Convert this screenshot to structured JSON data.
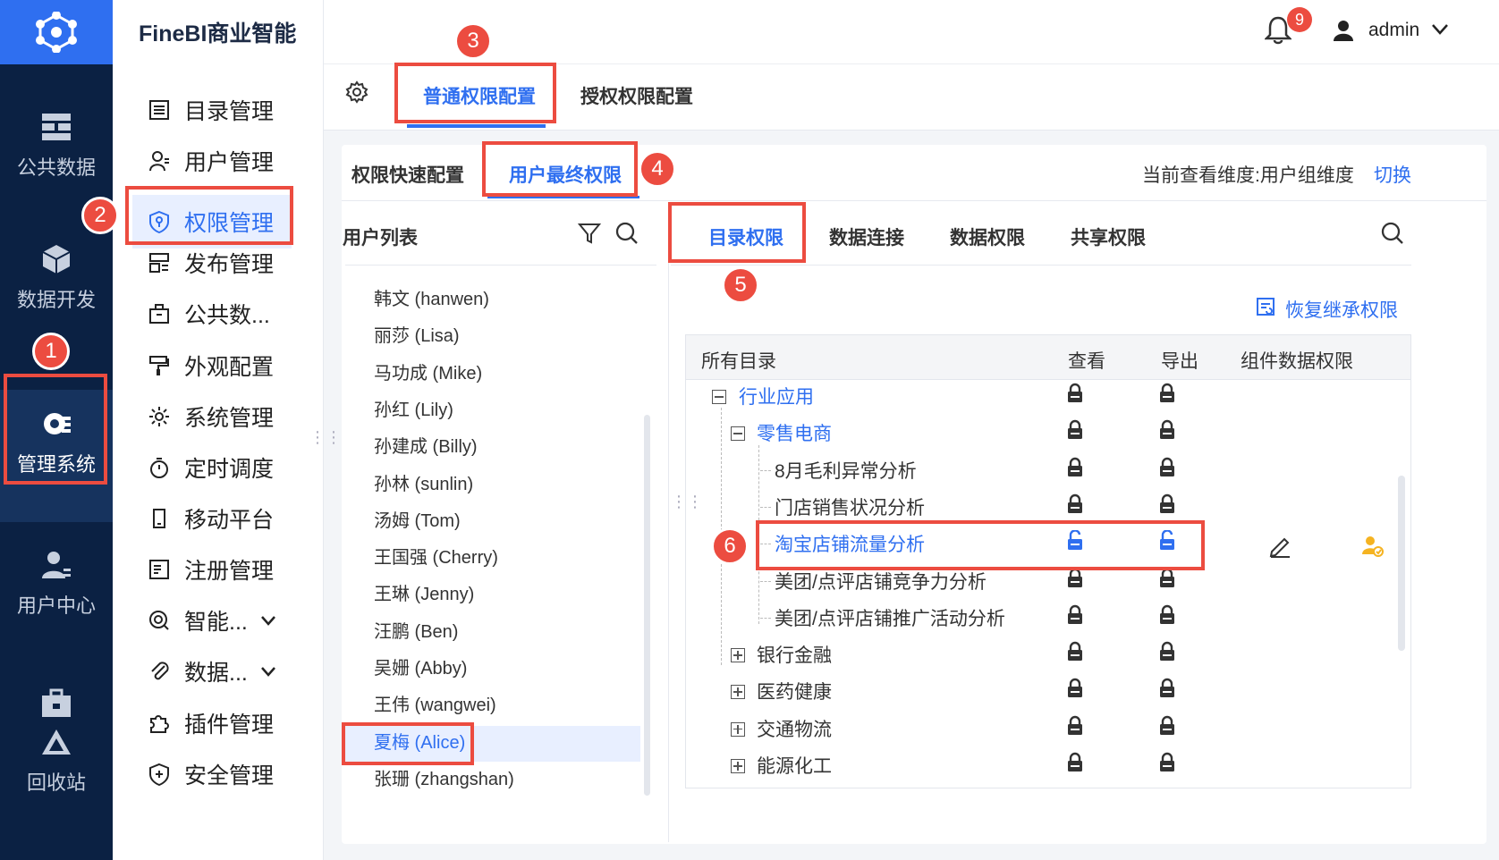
{
  "header": {
    "brand": "FineBI商业智能",
    "notifications": "9",
    "user": "admin"
  },
  "leftnav": {
    "items": [
      {
        "label": "公共数据"
      },
      {
        "label": "数据开发"
      },
      {
        "label": "管理系统"
      },
      {
        "label": "用户中心"
      },
      {
        "label": "回收站"
      }
    ]
  },
  "sidenav": {
    "items": [
      {
        "label": "目录管理"
      },
      {
        "label": "用户管理"
      },
      {
        "label": "权限管理"
      },
      {
        "label": "发布管理"
      },
      {
        "label": "公共数..."
      },
      {
        "label": "外观配置"
      },
      {
        "label": "系统管理"
      },
      {
        "label": "定时调度"
      },
      {
        "label": "移动平台"
      },
      {
        "label": "注册管理"
      },
      {
        "label": "智能..."
      },
      {
        "label": "数据..."
      },
      {
        "label": "插件管理"
      },
      {
        "label": "安全管理"
      }
    ]
  },
  "toptabs": {
    "normal": "普通权限配置",
    "grant": "授权权限配置"
  },
  "subtabs": {
    "quick": "权限快速配置",
    "final": "用户最终权限",
    "dimension": "当前查看维度:用户组维度",
    "switch": "切换"
  },
  "userlist": {
    "title": "用户列表",
    "users": [
      "韩文 (hanwen)",
      "丽莎 (Lisa)",
      "马功成 (Mike)",
      "孙红 (Lily)",
      "孙建成 (Billy)",
      "孙林 (sunlin)",
      "汤姆 (Tom)",
      "王国强 (Cherry)",
      "王琳 (Jenny)",
      "汪鹏 (Ben)",
      "吴姗 (Abby)",
      "王伟 (wangwei)",
      "夏梅 (Alice)",
      "张珊 (zhangshan)"
    ]
  },
  "permtabs": {
    "catalog": "目录权限",
    "connection": "数据连接",
    "data": "数据权限",
    "share": "共享权限",
    "restore": "恢复继承权限"
  },
  "table": {
    "headers": {
      "dir": "所有目录",
      "view": "查看",
      "export": "导出",
      "component": "组件数据权限"
    },
    "rows": [
      {
        "label": "行业应用"
      },
      {
        "label": "零售电商"
      },
      {
        "label": "8月毛利异常分析"
      },
      {
        "label": "门店销售状况分析"
      },
      {
        "label": "淘宝店铺流量分析"
      },
      {
        "label": "美团/点评店铺竞争力分析"
      },
      {
        "label": "美团/点评店铺推广活动分析"
      },
      {
        "label": "银行金融"
      },
      {
        "label": "医药健康"
      },
      {
        "label": "交通物流"
      },
      {
        "label": "能源化工"
      }
    ]
  },
  "steps": [
    "1",
    "2",
    "3",
    "4",
    "5",
    "6"
  ],
  "colors": {
    "accent": "#2f6ff0",
    "annotation": "#ec4c40",
    "nav": "#0b2143"
  }
}
